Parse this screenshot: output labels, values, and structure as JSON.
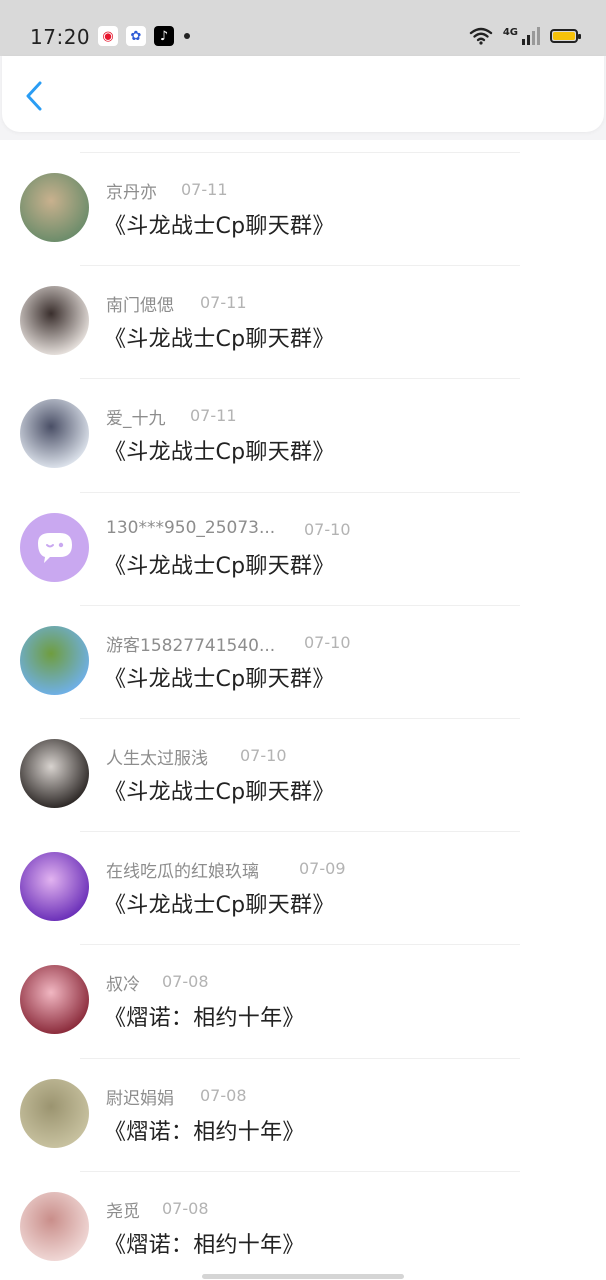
{
  "status_bar": {
    "time": "17:20",
    "network": "4G",
    "app_icons": [
      "weibo-icon",
      "baidu-icon",
      "tiktok-icon"
    ]
  },
  "header": {
    "back_icon": "chevron-left-icon",
    "accent": "#2a9df4"
  },
  "items": [
    {
      "name": "京丹亦",
      "date": "07-11",
      "message": "《斗龙战士Cp聊天群》",
      "avatar_colors": [
        "#6b8c6a",
        "#c9b18e"
      ]
    },
    {
      "name": "南门偲偲",
      "date": "07-11",
      "message": "《斗龙战士Cp聊天群》",
      "avatar_colors": [
        "#e7e1dd",
        "#3a2f2d"
      ]
    },
    {
      "name": "爱_十九",
      "date": "07-11",
      "message": "《斗龙战士Cp聊天群》",
      "avatar_colors": [
        "#dde3ec",
        "#4a4f66"
      ]
    },
    {
      "name": "130***950_25073...",
      "date": "07-10",
      "message": "《斗龙战士Cp聊天群》",
      "avatar_colors": [
        "#c9a8f0",
        "#c9a8f0"
      ]
    },
    {
      "name": "游客15827741540...",
      "date": "07-10",
      "message": "《斗龙战士Cp聊天群》",
      "avatar_colors": [
        "#6fb0e8",
        "#6f9d3f"
      ]
    },
    {
      "name": "人生太过服浅",
      "date": "07-10",
      "message": "《斗龙战士Cp聊天群》",
      "avatar_colors": [
        "#2c2725",
        "#d8d3cf"
      ]
    },
    {
      "name": "在线吃瓜的红娘玖璃",
      "date": "07-09",
      "message": "《斗龙战士Cp聊天群》",
      "avatar_colors": [
        "#6a2fb8",
        "#e2b3f0"
      ]
    },
    {
      "name": "叔冷",
      "date": "07-08",
      "message": "《熠诺：相约十年》",
      "avatar_colors": [
        "#8a2a3a",
        "#f1b7c2"
      ]
    },
    {
      "name": "尉迟娟娟",
      "date": "07-08",
      "message": "《熠诺：相约十年》",
      "avatar_colors": [
        "#c8c2a0",
        "#9b9470"
      ]
    },
    {
      "name": "尧觅",
      "date": "07-08",
      "message": "《熠诺：相约十年》",
      "avatar_colors": [
        "#f0d8d6",
        "#c98e8a"
      ]
    }
  ]
}
